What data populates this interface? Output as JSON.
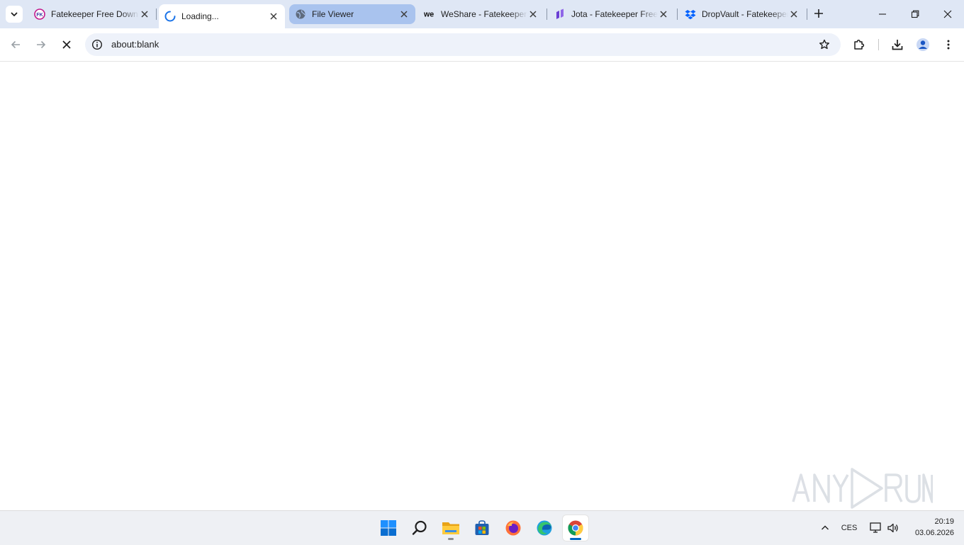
{
  "browser": {
    "tabs": [
      {
        "title": "Fatekeeper Free Download",
        "favicon": "fatekeeper-icon",
        "state": "normal"
      },
      {
        "title": "Loading...",
        "favicon": "loading-spinner-icon",
        "state": "active"
      },
      {
        "title": "File Viewer",
        "favicon": "globe-icon",
        "state": "hover"
      },
      {
        "title": "WeShare - Fatekeeper",
        "favicon": "weshare-icon",
        "state": "normal"
      },
      {
        "title": "Jota - Fatekeeper Free",
        "favicon": "jota-icon",
        "state": "normal"
      },
      {
        "title": "DropVault - Fatekeeper",
        "favicon": "dropvault-icon",
        "state": "normal"
      }
    ],
    "address_bar": {
      "url": "about:blank"
    }
  },
  "watermark": {
    "text": "ANY RUN"
  },
  "taskbar": {
    "apps": [
      {
        "name": "windows-start-icon",
        "active": false,
        "running": false
      },
      {
        "name": "search-icon",
        "active": false,
        "running": false
      },
      {
        "name": "file-explorer-icon",
        "active": false,
        "running": true
      },
      {
        "name": "microsoft-store-icon",
        "active": false,
        "running": false
      },
      {
        "name": "firefox-icon",
        "active": false,
        "running": false
      },
      {
        "name": "edge-icon",
        "active": false,
        "running": false
      },
      {
        "name": "chrome-icon",
        "active": true,
        "running": true
      }
    ],
    "tray": {
      "language": "CES",
      "time": "20:19",
      "date": "03.06.2026"
    }
  },
  "colors": {
    "tabstrip": "#dfe7f5",
    "active_tab": "#ffffff",
    "hover_tab": "#a9c3ee",
    "omnibox": "#eef2fa",
    "taskbar": "#eef0f4",
    "accent": "#0067c0"
  }
}
